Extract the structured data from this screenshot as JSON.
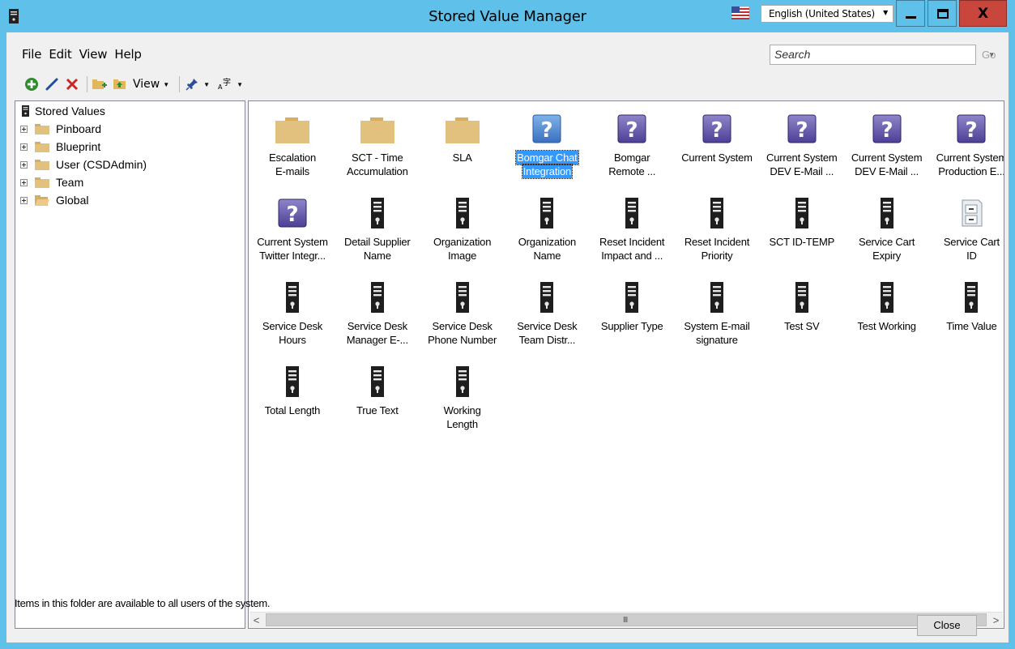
{
  "window": {
    "title": "Stored Value Manager",
    "language": "English (United States)",
    "close_glyph": "X"
  },
  "menu": [
    "File",
    "Edit",
    "View",
    "Help"
  ],
  "search": {
    "placeholder": "Search",
    "go_label": "Go"
  },
  "toolbar": {
    "view_label": "View",
    "icons": [
      "add-icon",
      "edit-icon",
      "delete-icon",
      "new-folder-icon",
      "move-up-folder-icon",
      "pin-icon",
      "language-icon"
    ]
  },
  "tree": {
    "root": "Stored Values",
    "children": [
      "Pinboard",
      "Blueprint",
      "User (CSDAdmin)",
      "Team",
      "Global"
    ]
  },
  "items": [
    {
      "line1": "Escalation",
      "line2": "E-mails",
      "icon": "folder"
    },
    {
      "line1": "SCT - Time",
      "line2": "Accumulation",
      "icon": "folder"
    },
    {
      "line1": "SLA",
      "line2": "",
      "icon": "folder"
    },
    {
      "line1": "Bomgar Chat",
      "line2": "Integration",
      "icon": "question",
      "selected": true
    },
    {
      "line1": "Bomgar",
      "line2": "Remote ...",
      "icon": "question"
    },
    {
      "line1": "Current System",
      "line2": "",
      "icon": "question"
    },
    {
      "line1": "Current System",
      "line2": "DEV E-Mail ...",
      "icon": "question"
    },
    {
      "line1": "Current System",
      "line2": "DEV E-Mail ...",
      "icon": "question"
    },
    {
      "line1": "Current System",
      "line2": "Production E...",
      "icon": "question"
    },
    {
      "line1": "Current System",
      "line2": "Twitter Integr...",
      "icon": "question"
    },
    {
      "line1": "Detail Supplier",
      "line2": "Name",
      "icon": "stored-value"
    },
    {
      "line1": "Organization",
      "line2": "Image",
      "icon": "stored-value"
    },
    {
      "line1": "Organization",
      "line2": "Name",
      "icon": "stored-value"
    },
    {
      "line1": "Reset Incident",
      "line2": "Impact and ...",
      "icon": "stored-value"
    },
    {
      "line1": "Reset Incident",
      "line2": "Priority",
      "icon": "stored-value"
    },
    {
      "line1": "SCT ID-TEMP",
      "line2": "",
      "icon": "stored-value"
    },
    {
      "line1": "Service Cart",
      "line2": "Expiry",
      "icon": "stored-value"
    },
    {
      "line1": "Service Cart",
      "line2": "ID",
      "icon": "cabinet"
    },
    {
      "line1": "Service Desk",
      "line2": "Hours",
      "icon": "stored-value"
    },
    {
      "line1": "Service Desk",
      "line2": "Manager E-...",
      "icon": "stored-value"
    },
    {
      "line1": "Service Desk",
      "line2": "Phone Number",
      "icon": "stored-value"
    },
    {
      "line1": "Service Desk",
      "line2": "Team Distr...",
      "icon": "stored-value"
    },
    {
      "line1": "Supplier Type",
      "line2": "",
      "icon": "stored-value"
    },
    {
      "line1": "System E-mail",
      "line2": "signature",
      "icon": "stored-value"
    },
    {
      "line1": "Test SV",
      "line2": "",
      "icon": "stored-value"
    },
    {
      "line1": "Test Working",
      "line2": "",
      "icon": "stored-value"
    },
    {
      "line1": "Time Value",
      "line2": "",
      "icon": "stored-value"
    },
    {
      "line1": "Total Length",
      "line2": "",
      "icon": "stored-value"
    },
    {
      "line1": "True Text",
      "line2": "",
      "icon": "stored-value"
    },
    {
      "line1": "Working",
      "line2": "Length",
      "icon": "stored-value"
    }
  ],
  "scrollbar": {
    "grip": "III"
  },
  "status_text": "Items in this folder are available to all users of the system.",
  "close_button": "Close",
  "colors": {
    "titlebar": "#5fc1ea",
    "selection": "#3399ff",
    "close": "#c9463d",
    "folder": "#e2c07d"
  }
}
